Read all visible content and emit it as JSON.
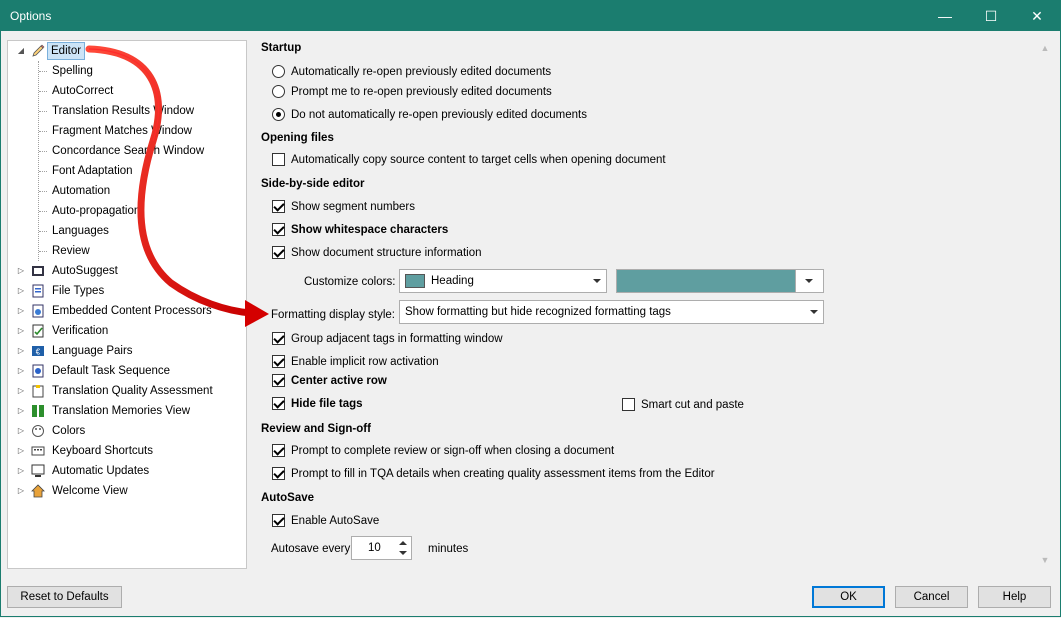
{
  "window": {
    "title": "Options",
    "controls": {
      "minimize": "—",
      "maximize": "☐",
      "close": "✕"
    }
  },
  "tree": {
    "editor": {
      "label": "Editor",
      "children": [
        "Spelling",
        "AutoCorrect",
        "Translation Results Window",
        "Fragment Matches Window",
        "Concordance Search Window",
        "Font Adaptation",
        "Automation",
        "Auto-propagation",
        "Languages",
        "Review"
      ]
    },
    "top_items": [
      {
        "label": "AutoSuggest",
        "icon": "autosuggest-icon"
      },
      {
        "label": "File Types",
        "icon": "file-types-icon"
      },
      {
        "label": "Embedded Content Processors",
        "icon": "gear-icon"
      },
      {
        "label": "Verification",
        "icon": "verification-icon"
      },
      {
        "label": "Language Pairs",
        "icon": "language-pairs-icon"
      },
      {
        "label": "Default Task Sequence",
        "icon": "task-sequence-icon"
      },
      {
        "label": "Translation Quality Assessment",
        "icon": "clipboard-icon"
      },
      {
        "label": "Translation Memories View",
        "icon": "translation-memory-icon"
      },
      {
        "label": "Colors",
        "icon": "palette-icon"
      },
      {
        "label": "Keyboard Shortcuts",
        "icon": "keyboard-icon"
      },
      {
        "label": "Automatic Updates",
        "icon": "updates-icon"
      },
      {
        "label": "Welcome View",
        "icon": "home-icon"
      }
    ]
  },
  "startup": {
    "heading": "Startup",
    "options": [
      {
        "label": "Automatically re-open previously edited documents",
        "selected": false
      },
      {
        "label": "Prompt me to re-open previously edited documents",
        "selected": false
      },
      {
        "label": "Do not automatically re-open previously edited documents",
        "selected": true
      }
    ]
  },
  "opening_files": {
    "heading": "Opening files",
    "copy_source": {
      "label": "Automatically copy source content to target cells when opening document",
      "checked": false
    }
  },
  "side_by_side": {
    "heading": "Side-by-side editor",
    "show_segment_numbers": {
      "label": "Show segment numbers",
      "checked": true
    },
    "show_whitespace": {
      "label": "Show whitespace characters",
      "checked": true
    },
    "show_structure": {
      "label": "Show document structure information",
      "checked": true
    },
    "customize_colors": {
      "label": "Customize colors:",
      "value": "Heading",
      "color": "#5f9ea0"
    },
    "formatting_style": {
      "label": "Formatting display style:",
      "value": "Show formatting but hide recognized formatting tags"
    },
    "group_tags": {
      "label": "Group adjacent tags in formatting window",
      "checked": true
    },
    "implicit_row": {
      "label": "Enable implicit row activation",
      "checked": true
    },
    "center_row": {
      "label": "Center active row",
      "checked": true
    },
    "hide_file_tags": {
      "label": "Hide file tags",
      "checked": true
    },
    "smart_cut": {
      "label": "Smart cut and paste",
      "checked": false
    }
  },
  "review": {
    "heading": "Review and Sign-off",
    "prompt_review": {
      "label": "Prompt to complete review or sign-off when closing a document",
      "checked": true
    },
    "prompt_tqa": {
      "label": "Prompt to fill in TQA details when creating quality assessment items from the Editor",
      "checked": true
    }
  },
  "autosave": {
    "heading": "AutoSave",
    "enable": {
      "label": "Enable AutoSave",
      "checked": true
    },
    "every_label": "Autosave every",
    "value": "10",
    "unit": "minutes"
  },
  "buttons": {
    "reset": "Reset to Defaults",
    "ok": "OK",
    "cancel": "Cancel",
    "help": "Help"
  },
  "colors": {
    "titlebar": "#1b7d6f",
    "selection": "#cce4f7",
    "accent_arrow": "#e01010"
  }
}
